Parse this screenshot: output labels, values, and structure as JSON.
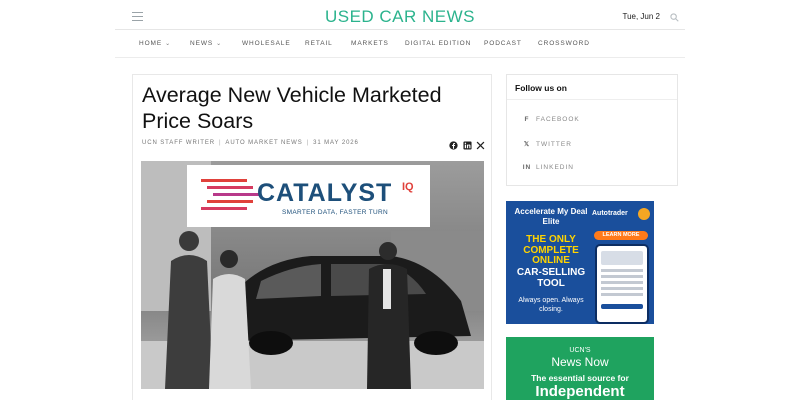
{
  "header": {
    "site_title": "USED CAR NEWS",
    "date": "Tue, Jun 2",
    "brand_color": "#2bb38d"
  },
  "nav": {
    "items": [
      {
        "label": "HOME",
        "has_dropdown": true
      },
      {
        "label": "NEWS",
        "has_dropdown": true
      },
      {
        "label": "WHOLESALE",
        "has_dropdown": false
      },
      {
        "label": "RETAIL",
        "has_dropdown": false
      },
      {
        "label": "MARKETS",
        "has_dropdown": false
      },
      {
        "label": "DIGITAL EDITION",
        "has_dropdown": false
      },
      {
        "label": "PODCAST",
        "has_dropdown": false
      },
      {
        "label": "CROSSWORD",
        "has_dropdown": false
      }
    ]
  },
  "article": {
    "headline": "Average New Vehicle Marketed Price Soars",
    "author": "UCN STAFF WRITER",
    "category": "AUTO MARKET NEWS",
    "date": "31 MAY 2026",
    "share_icons": [
      "facebook-icon",
      "linkedin-icon",
      "x-icon"
    ],
    "hero": {
      "logo_text": "CATALYST",
      "logo_suffix": "IQ",
      "tagline": "SMARTER DATA, FASTER TURN",
      "logo_color": "#1d4f7a",
      "accent_color": "#e0413b"
    }
  },
  "sidebar": {
    "follow_title": "Follow us on",
    "social": [
      {
        "icon": "f",
        "label": "FACEBOOK"
      },
      {
        "icon": "𝕏",
        "label": "TWITTER"
      },
      {
        "icon": "in",
        "label": "LINKEDIN"
      }
    ],
    "ad1": {
      "headline": "Accelerate My Deal Elite",
      "yellow_text": "THE ONLY COMPLETE ONLINE",
      "white_text": "CAR-SELLING TOOL",
      "sub": "Always open. Always closing.",
      "brand": "Autotrader",
      "cta": "LEARN MORE",
      "bg_color": "#1a4f9c"
    },
    "ad2": {
      "line1": "UCN'S",
      "line2": "News Now",
      "line3": "The essential source for",
      "line4": "Independent",
      "bg_color": "#1fa35f"
    }
  }
}
